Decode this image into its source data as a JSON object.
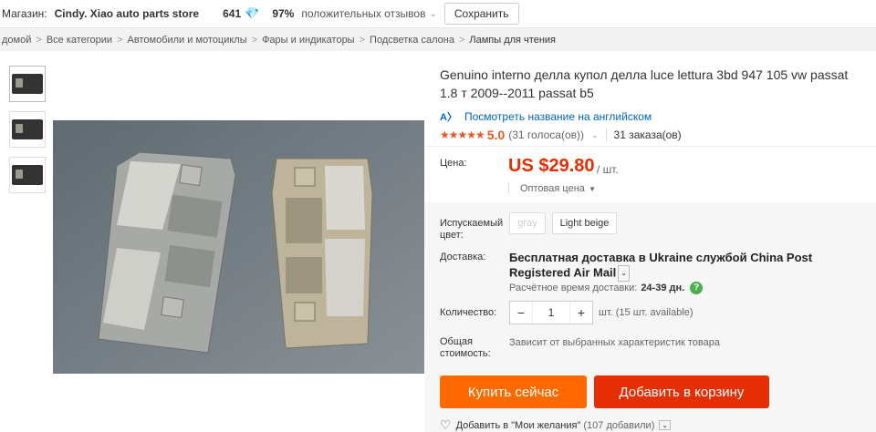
{
  "store_bar": {
    "label": "Магазин:",
    "store_name": "Cindy. Xiao auto parts store",
    "score": "641",
    "positive_pct": "97%",
    "positive_label": "положительных отзывов",
    "save_label": "Сохранить"
  },
  "breadcrumb": {
    "items": [
      "домой",
      "Все категории",
      "Автомобили и мотоциклы",
      "Фары и индикаторы",
      "Подсветка салона",
      "Лампы для чтения"
    ]
  },
  "product": {
    "title": "Genuino interno делла купол делла luce lettura 3bd 947 105 vw passat 1.8 т 2009--2011 passat b5",
    "translate_link": "Посмотреть название на английском",
    "stars": "★★★★★",
    "rating": "5.0",
    "votes": "(31 голоса(ов))",
    "orders": "31 заказа(ов)"
  },
  "price": {
    "label": "Цена:",
    "value": "US $29.80",
    "unit": "/ шт.",
    "wholesale": "Оптовая цена"
  },
  "options": {
    "color_label_1": "Испускаемый",
    "color_label_2": "цвет:",
    "colors": [
      "gray",
      "Light beige"
    ],
    "shipping_label": "Доставка:",
    "shipping_text": "Бесплатная доставка в Ukraine службой China Post Registered Air Mail",
    "delivery_time_label": "Расчётное время доставки:",
    "delivery_time": "24-39 дн.",
    "qty_label": "Количество:",
    "qty_value": "1",
    "qty_minus": "−",
    "qty_plus": "+",
    "qty_note": "шт. (15 шт. available)",
    "total_label_1": "Общая",
    "total_label_2": "стоимость:",
    "total_note": "Зависит от выбранных характеристик товара"
  },
  "actions": {
    "buy_now": "Купить сейчас",
    "add_to_cart": "Добавить в корзину",
    "wishlist": "Добавить в \"Мои желания\"",
    "wishlist_count": "(107 добавили)"
  },
  "colors": {
    "price_red": "#e62e04",
    "buy_orange": "#ff6a00",
    "cart_red": "#e62e04",
    "link_blue": "#0066c0"
  }
}
